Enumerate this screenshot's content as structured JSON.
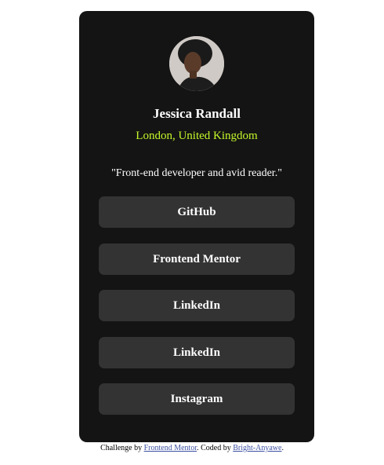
{
  "profile": {
    "name": "Jessica Randall",
    "location": "London, United Kingdom",
    "bio": "\"Front-end developer and avid reader.\""
  },
  "links": [
    {
      "label": "GitHub"
    },
    {
      "label": "Frontend Mentor"
    },
    {
      "label": "LinkedIn"
    },
    {
      "label": "LinkedIn"
    },
    {
      "label": "Instagram"
    }
  ],
  "footer": {
    "prefix": "Challenge by ",
    "challenge_link": "Frontend Mentor",
    "middle": ". Coded by ",
    "author_link": "Bright-Anyawe",
    "suffix": "."
  },
  "colors": {
    "card_bg": "#141414",
    "button_bg": "#333333",
    "accent": "#c4f82a",
    "link": "#3e52a3"
  },
  "icons": {
    "avatar": "profile-photo"
  }
}
